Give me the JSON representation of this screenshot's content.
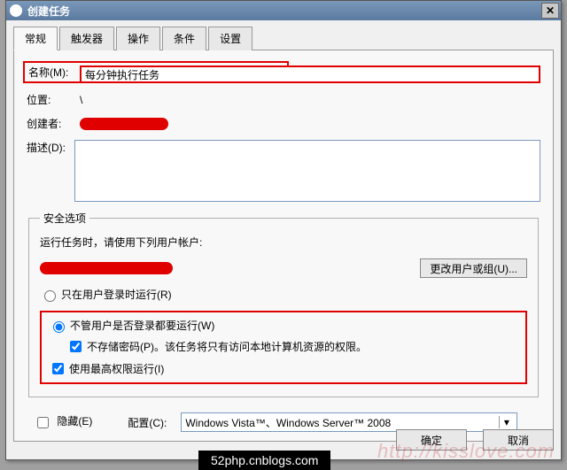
{
  "window": {
    "title": "创建任务"
  },
  "tabs": [
    "常规",
    "触发器",
    "操作",
    "条件",
    "设置"
  ],
  "general": {
    "name_label": "名称(M):",
    "name_value": "每分钟执行任务",
    "location_label": "位置:",
    "location_value": "\\",
    "author_label": "创建者:",
    "desc_label": "描述(D):",
    "desc_value": ""
  },
  "security": {
    "legend": "安全选项",
    "run_as_label": "运行任务时，请使用下列用户帐户:",
    "change_user_btn": "更改用户或组(U)...",
    "radio_logged_on": "只在用户登录时运行(R)",
    "radio_any": "不管用户是否登录都要运行(W)",
    "no_store_pw": "不存储密码(P)。该任务将只有访问本地计算机资源的权限。",
    "highest": "使用最高权限运行(I)",
    "radio_selected": "any",
    "no_store_pw_checked": true,
    "highest_checked": true
  },
  "footer": {
    "hidden_label": "隐藏(E)",
    "hidden_checked": false,
    "config_label": "配置(C):",
    "config_value": "Windows Vista™、Windows Server™ 2008",
    "ok": "确定",
    "cancel": "取消"
  },
  "watermark": "http://kisslove.com",
  "blackbar": "52php.cnblogs.com"
}
